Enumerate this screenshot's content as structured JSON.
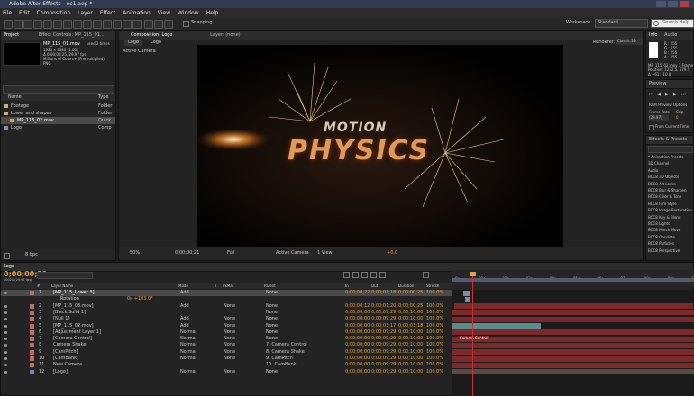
{
  "app": {
    "title": "Adobe After Effects - ec1.aep *"
  },
  "menu": [
    "File",
    "Edit",
    "Composition",
    "Layer",
    "Effect",
    "Animation",
    "View",
    "Window",
    "Help"
  ],
  "toolbar": {
    "snapping": "Snapping",
    "workspace_label": "Workspace:",
    "workspace_value": "Standard",
    "search_placeholder": "Search Help"
  },
  "project": {
    "tab": "Project",
    "effect_tab": "Effect Controls: MP_115_01...",
    "selected_name": "MP_115_01.mov",
    "selected_info": [
      "1920 x 1080 (1.00)",
      "Δ 0;00;00;25, 29.97 fps",
      "Millions of Colors+ (Premultiplied)",
      "PNG"
    ],
    "used": "used 2 times",
    "columns": [
      "Name",
      "Type"
    ],
    "items": [
      {
        "name": "Footage",
        "type": "Folder"
      },
      {
        "name": "Lower and shapes",
        "type": "Folder"
      },
      {
        "name": "MP_115_02.mov",
        "type": "Quick"
      },
      {
        "name": "Logo",
        "type": "Comp"
      }
    ],
    "bpc": "8 bpc"
  },
  "composition": {
    "tab": "Composition: Logo",
    "layer_tab": "Layer: (none)",
    "breadcrumb": "Logo",
    "active_camera": "Active Camera",
    "renderer": "Renderer:",
    "renderer_value": "Classic 3D",
    "footer": {
      "zoom": "50%",
      "time": "0;00;00;21",
      "res": "Full",
      "camera": "Active Camera",
      "views": "1 View",
      "offset": "+0.0"
    },
    "title_word1": "MOTION",
    "title_word2": "PHYSICS"
  },
  "info_panel": {
    "tab": "Info",
    "audio_tab": "Audio",
    "r": "R : 255",
    "g": "G : 255",
    "b": "B : 255",
    "a": "A : 255",
    "file": "MP_115_02.mov 3 Frame",
    "position": "Position: 1232.5, 579.5",
    "delta": "Δ +61, -10.0"
  },
  "preview": {
    "tab": "Preview",
    "ram": "RAM Preview Options",
    "frame_rate": "Frame Rate",
    "skip": "Skip",
    "fps": "(29.97)",
    "skip_val": "0",
    "from_current": "From Current Time"
  },
  "effects": {
    "tab": "Effects & Presets",
    "items": [
      "* Animation Presets",
      "3D Channel",
      "Audio",
      "BCC8 3D Objects",
      "BCC8 Art Looks",
      "BCC8 Blur & Sharpen",
      "BCC8 Color & Tone",
      "BCC8 Film Style",
      "BCC8 Image Restoration",
      "BCC8 Key & Blend",
      "BCC8 Lights",
      "BCC8 Match Move",
      "BCC8 Obsolete",
      "BCC8 Particles",
      "BCC8 Perspective"
    ]
  },
  "timeline": {
    "tab": "Logo",
    "timecode": "0;00;00;21",
    "fps_label": "00021 (29.97 fps)",
    "columns": [
      "#",
      "Layer Name",
      "Mode",
      "T",
      "TrkMat",
      "Parent",
      "In",
      "Out",
      "Duration",
      "Stretch"
    ],
    "ruler": [
      "0s",
      "01s",
      "02s",
      "03s",
      "04s",
      "05s",
      "06s",
      "07s",
      "08s",
      "09s",
      "10s"
    ],
    "layers": [
      {
        "num": "1",
        "name": "[MP_115_Lower 3]",
        "mode": "Add",
        "trk": "",
        "parent": "None",
        "in": "0;00;00;22",
        "out": "0;00;01;18",
        "dur": "0;00;00;25",
        "stretch": "100.0%",
        "color": "#c06a6a",
        "selected": true
      },
      {
        "num": "",
        "name": "Rotation",
        "mode": "",
        "trk": "",
        "parent": "",
        "in": "",
        "out": "",
        "dur": "",
        "stretch": "",
        "color": "",
        "selected": false,
        "sub": "0x +103.0°"
      },
      {
        "num": "2",
        "name": "[MP_115_03.mov]",
        "mode": "Add",
        "trk": "None",
        "parent": "None",
        "in": "0;00;00;12",
        "out": "0;00;01;20",
        "dur": "0;00;00;25",
        "stretch": "100.0%",
        "color": "#c06a6a",
        "selected": false
      },
      {
        "num": "3",
        "name": "[Black Solid 1]",
        "mode": "",
        "trk": "",
        "parent": "None",
        "in": "0;00;00;00",
        "out": "0;00;09;29",
        "dur": "0;00;10;00",
        "stretch": "100.0%",
        "color": "#c06a6a",
        "selected": false
      },
      {
        "num": "4",
        "name": "[Null 1]",
        "mode": "Add",
        "trk": "None",
        "parent": "None",
        "in": "0;00;00;00",
        "out": "0;00;09;29",
        "dur": "0;00;10;00",
        "stretch": "100.0%",
        "color": "#c06a6a",
        "selected": false
      },
      {
        "num": "5",
        "name": "[MP_115_02.mov]",
        "mode": "Add",
        "trk": "None",
        "parent": "None",
        "in": "0;00;00;00",
        "out": "0;00;03;17",
        "dur": "0;00;03;18",
        "stretch": "100.0%",
        "color": "#c06a6a",
        "selected": false
      },
      {
        "num": "6",
        "name": "[Adjustment Layer 1]",
        "mode": "Normal",
        "trk": "None",
        "parent": "None",
        "in": "0;00;00;00",
        "out": "0;00;09;29",
        "dur": "0;00;10;00",
        "stretch": "100.0%",
        "color": "#c06a6a",
        "selected": false
      },
      {
        "num": "7",
        "name": "[Camera Control]",
        "mode": "Normal",
        "trk": "None",
        "parent": "None",
        "in": "0;00;00;00",
        "out": "0;00;09;29",
        "dur": "0;00;10;00",
        "stretch": "100.0%",
        "color": "#c06a6a",
        "selected": false
      },
      {
        "num": "8",
        "name": "Camera Shake",
        "mode": "Normal",
        "trk": "None",
        "parent": "7. Camera Control",
        "in": "0;00;00;00",
        "out": "0;00;09;29",
        "dur": "0;00;10;00",
        "stretch": "100.0%",
        "color": "#c06a6a",
        "selected": false
      },
      {
        "num": "9",
        "name": "[CamPitch]",
        "mode": "Normal",
        "trk": "None",
        "parent": "8. Camera Shake",
        "in": "0;00;00;00",
        "out": "0;00;09;29",
        "dur": "0;00;10;00",
        "stretch": "100.0%",
        "color": "#c06a6a",
        "selected": false
      },
      {
        "num": "10",
        "name": "[CamBank]",
        "mode": "Normal",
        "trk": "None",
        "parent": "9. CamPitch",
        "in": "0;00;00;00",
        "out": "0;00;09;29",
        "dur": "0;00;10;00",
        "stretch": "100.0%",
        "color": "#c06a6a",
        "selected": false
      },
      {
        "num": "11",
        "name": "New Camera",
        "mode": "",
        "trk": "",
        "parent": "10. CamBank",
        "in": "0;00;00;00",
        "out": "0;00;09;29",
        "dur": "0;00;10;00",
        "stretch": "100.0%",
        "color": "#c06a6a",
        "selected": false
      },
      {
        "num": "12",
        "name": "[Logo]",
        "mode": "Normal",
        "trk": "None",
        "parent": "None",
        "in": "0;00;00;00",
        "out": "0;00;09;29",
        "dur": "0;00;10;00",
        "stretch": "100.0%",
        "color": "#6a8ac0",
        "selected": false
      }
    ],
    "bar_labels": {
      "camera_control": "Camera Control"
    }
  },
  "colors": {
    "accent_orange": "#e6a23c",
    "bar_red": "#7a2a2a",
    "bar_lavender": "#8a86a8",
    "bar_teal": "#5a8a8a"
  }
}
